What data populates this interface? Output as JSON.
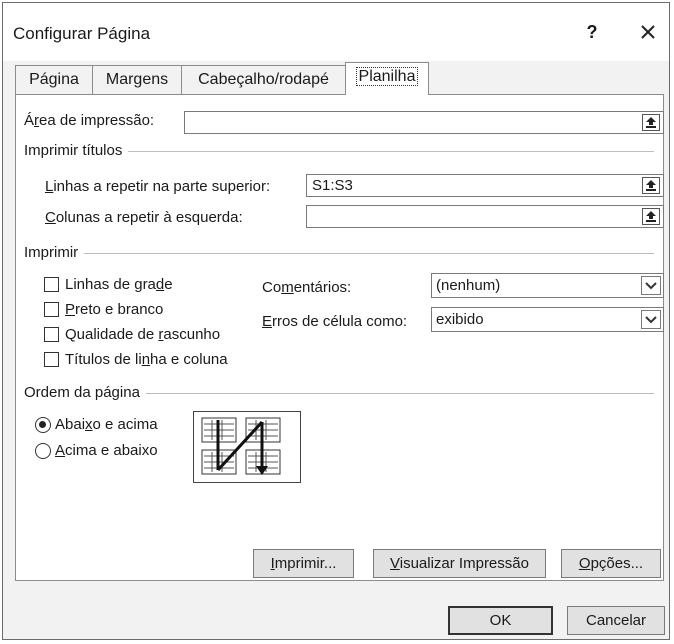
{
  "window": {
    "title": "Configurar Página",
    "help": "?"
  },
  "tabs": [
    {
      "label": "Página"
    },
    {
      "label": "Margens"
    },
    {
      "label": "Cabeçalho/rodapé"
    },
    {
      "label": "Planilha",
      "active": true
    }
  ],
  "print_area": {
    "label_pre": "Á",
    "label_u": "r",
    "label_post": "ea de impressão:",
    "value": ""
  },
  "print_titles": {
    "group_title": "Imprimir títulos",
    "rows": {
      "label_u": "L",
      "label_post": "inhas a repetir na parte superior:",
      "value": "S1:S3"
    },
    "cols": {
      "label_u": "C",
      "label_post": "olunas a repetir à esquerda:",
      "value": ""
    }
  },
  "print": {
    "group_title": "Imprimir",
    "gridlines": {
      "pre": "Linhas de gra",
      "u": "d",
      "post": "e",
      "checked": false
    },
    "black_white": {
      "pre": "",
      "u": "P",
      "post": "reto e branco",
      "checked": false
    },
    "draft": {
      "pre": "Qualidade de ",
      "u": "r",
      "post": "ascunho",
      "checked": false
    },
    "headings": {
      "pre": "Títulos de li",
      "u": "n",
      "post": "ha e coluna",
      "checked": false
    },
    "comments": {
      "label_pre": "Co",
      "label_u": "m",
      "label_post": "entários:",
      "value": "(nenhum)"
    },
    "errors": {
      "label_pre": "",
      "label_u": "E",
      "label_post": "rros de célula como:",
      "value": "exibido"
    }
  },
  "page_order": {
    "group_title": "Ordem da página",
    "down_then_over": {
      "pre": "Abai",
      "u": "x",
      "post": "o e acima",
      "selected": true
    },
    "over_then_down": {
      "pre": "",
      "u": "A",
      "post": "cima e abaixo",
      "selected": false
    }
  },
  "buttons": {
    "print": {
      "pre": "",
      "u": "I",
      "post": "mprimir..."
    },
    "preview": {
      "pre": "",
      "u": "V",
      "post": "isualizar Impressão"
    },
    "options": {
      "pre": "",
      "u": "O",
      "post": "pções..."
    },
    "ok": "OK",
    "cancel": "Cancelar"
  }
}
